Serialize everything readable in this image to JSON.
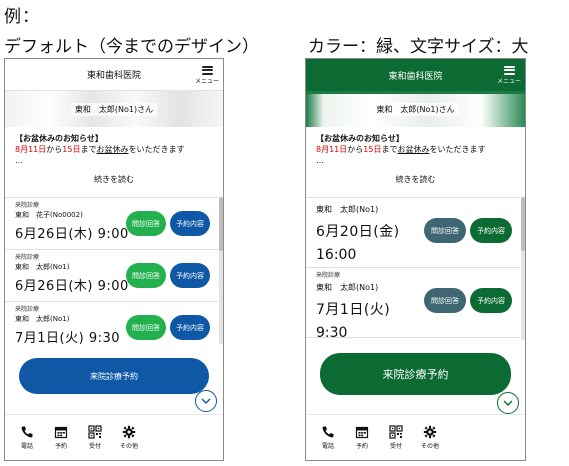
{
  "heading": "例：",
  "captions": {
    "left": "デフォルト（今までのデザイン）",
    "right": "カラー：緑、文字サイズ：大"
  },
  "colors": {
    "default_accent": "#0e58a6",
    "default_questionnaire": "#23b14f",
    "green_accent": "#0c6b32",
    "green_questionnaire": "#3f6773",
    "notice_red": "#e10000"
  },
  "phone_default": {
    "clinic_name": "東和歯科医院",
    "menu_label": "メニュー",
    "patient_greeting": "東和　太郎(No1)さん",
    "notice_title": "【お盆休みのお知らせ】",
    "notice_date_from": "8月11日",
    "notice_from_word": "から",
    "notice_date_to": "15日",
    "notice_until_word": "まで",
    "notice_holiday_word": "お盆休み",
    "notice_rest": "をいただきます",
    "notice_ellipsis": "…",
    "read_more": "続きを読む",
    "appointments": [
      {
        "dept": "来院診療",
        "patient": "東和　花子(No0002)",
        "datetime": "6月26日(木) 9:00",
        "btn_q": "問診回答",
        "btn_r": "予約内容"
      },
      {
        "dept": "来院診療",
        "patient": "東和　太郎(No1)",
        "datetime": "6月26日(木) 9:00",
        "btn_q": "問診回答",
        "btn_r": "予約内容"
      },
      {
        "dept": "来院診療",
        "patient": "東和　太郎(No1)",
        "datetime": "7月1日(火) 9:30",
        "btn_q": "問診回答",
        "btn_r": "予約内容"
      }
    ],
    "book_button": "来院診療予約",
    "tabs": [
      {
        "label": "電話",
        "icon": "phone-icon"
      },
      {
        "label": "予約",
        "icon": "calendar-icon"
      },
      {
        "label": "受付",
        "icon": "qr-code-icon"
      },
      {
        "label": "その他",
        "icon": "gear-icon"
      }
    ]
  },
  "phone_green": {
    "clinic_name": "東和歯科医院",
    "menu_label": "メニュー",
    "patient_greeting": "東和　太郎(No1)さん",
    "notice_title": "【お盆休みのお知らせ】",
    "notice_date_from": "8月11日",
    "notice_from_word": "から",
    "notice_date_to": "15日",
    "notice_until_word": "まで",
    "notice_holiday_word": "お盆休み",
    "notice_rest": "をいただきます",
    "notice_ellipsis": "…",
    "read_more": "続きを読む",
    "appointments": [
      {
        "dept": "",
        "patient": "東和　太郎(No1)",
        "date": "6月20日(金)",
        "time": "16:00",
        "btn_q": "問診回答",
        "btn_r": "予約内容"
      },
      {
        "dept": "来院診療",
        "patient": "東和　太郎(No1)",
        "date": "7月1日(火)",
        "time": "9:30",
        "btn_q": "問診回答",
        "btn_r": "予約内容"
      }
    ],
    "book_button": "来院診療予約",
    "tabs": [
      {
        "label": "電話",
        "icon": "phone-icon"
      },
      {
        "label": "予約",
        "icon": "calendar-icon"
      },
      {
        "label": "受付",
        "icon": "qr-code-icon"
      },
      {
        "label": "その他",
        "icon": "gear-icon"
      }
    ]
  }
}
